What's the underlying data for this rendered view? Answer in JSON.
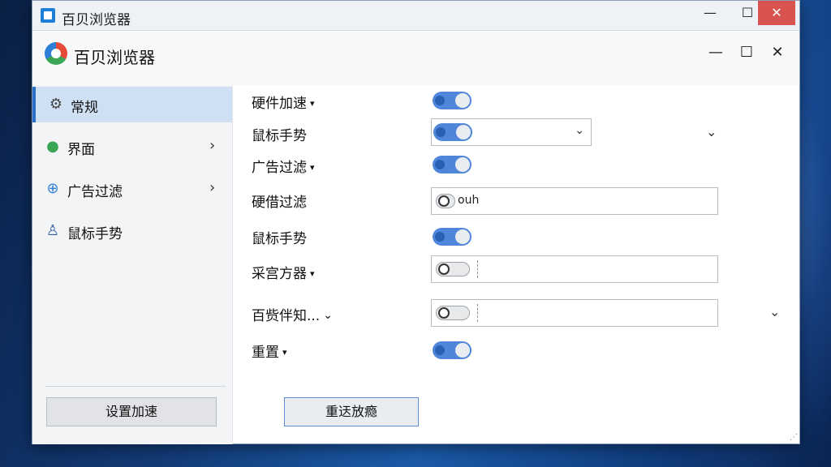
{
  "window": {
    "outer_title": "百贝浏览器",
    "inner_title": "百贝浏览器",
    "controls": {
      "minimize": "—",
      "maximize": "☐",
      "close": "✕"
    }
  },
  "sidebar": {
    "items": [
      {
        "label": "常规",
        "icon": "gear-icon",
        "active": true,
        "chevron": ""
      },
      {
        "label": "界面",
        "icon": "bulb-icon",
        "active": false,
        "chevron": "›"
      },
      {
        "label": "广告过滤",
        "icon": "globe-icon",
        "active": false,
        "chevron": "›"
      },
      {
        "label": "鼠标手势",
        "icon": "person-icon",
        "active": false,
        "chevron": ""
      }
    ],
    "speed_button": "设置加速"
  },
  "settings": {
    "rows": [
      {
        "label": "硬件加速",
        "caret": "▾",
        "control": "toggle"
      },
      {
        "label": "鼠标手势",
        "caret": "",
        "control": "select-toggle"
      },
      {
        "label": "广告过滤",
        "caret": "▾",
        "control": "toggle"
      },
      {
        "label": "硬借过滤",
        "caret": "",
        "control": "field",
        "value": "ouh"
      },
      {
        "label": "鼠标手势",
        "caret": "",
        "control": "toggle"
      },
      {
        "label": "采宫方器",
        "caret": "▾",
        "control": "field"
      },
      {
        "label": "百赀伴知...",
        "caret": "⌄",
        "control": "field"
      },
      {
        "label": "重置",
        "caret": "▾",
        "control": "toggle"
      }
    ],
    "reset_button": "重迗放瘾"
  },
  "colors": {
    "accent": "#4f86d9",
    "active_bg": "#cfe0f4",
    "close_red": "#d9534f"
  }
}
